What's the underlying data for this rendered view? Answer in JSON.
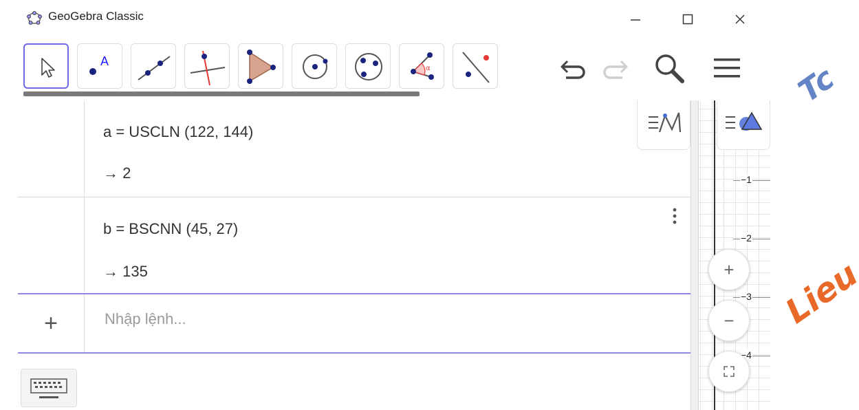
{
  "window": {
    "title": "GeoGebra Classic",
    "minimize": "–",
    "maximize": "☐",
    "close": "✕"
  },
  "toolbar": {
    "tools": [
      {
        "name": "move-tool",
        "icon": "cursor-arrow-icon",
        "selected": true
      },
      {
        "name": "point-tool",
        "icon": "point-icon",
        "selected": false
      },
      {
        "name": "line-tool",
        "icon": "line-icon",
        "selected": false
      },
      {
        "name": "perpendicular-line-tool",
        "icon": "perpendicular-line-icon",
        "selected": false
      },
      {
        "name": "polygon-tool",
        "icon": "polygon-icon",
        "selected": false
      },
      {
        "name": "circle-center-point-tool",
        "icon": "circle-center-icon",
        "selected": false
      },
      {
        "name": "circle-three-points-tool",
        "icon": "circle-three-points-icon",
        "selected": false
      },
      {
        "name": "angle-tool",
        "icon": "angle-icon",
        "selected": false
      },
      {
        "name": "reflect-tool",
        "icon": "reflect-icon",
        "selected": false
      }
    ],
    "point_label": "A",
    "angle_label": "α",
    "right": [
      "undo-icon",
      "redo-icon",
      "search-icon",
      "menu-icon"
    ]
  },
  "algebra": {
    "items": [
      {
        "command": "a = USCLN (122, 144)",
        "result": "→  2"
      },
      {
        "command": "b = BSCNN (45, 27)",
        "result": "→  135"
      }
    ],
    "input": {
      "plus": "+",
      "placeholder": "Nhập lệnh..."
    }
  },
  "graphics": {
    "y_ticks": [
      "−1",
      "−2",
      "−3",
      "−4"
    ],
    "zoom_in": "+",
    "zoom_out": "−"
  },
  "colors": {
    "accent": "#6f68e8",
    "point": "#1a237e",
    "polygon_fill": "#d7a48f",
    "angle": "#e53935"
  },
  "watermark": {
    "fragment_top": "Tc",
    "fragment_mid": "Lieu"
  }
}
